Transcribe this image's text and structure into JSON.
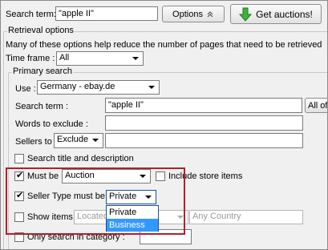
{
  "toolbar": {
    "search_label": "Search term:",
    "search_value": "\"apple II\"",
    "options_label": "Options",
    "options_icon": "double-chevron-up-icon",
    "get_auctions_label": "Get auctions!",
    "get_auctions_icon": "green-down-arrow-icon"
  },
  "retrieval": {
    "title": "Retrieval options",
    "description": "Many of these options help reduce the number of pages that need to be retrieved",
    "timeframe_label": "Time frame :",
    "timeframe_value": "All"
  },
  "primary": {
    "title": "Primary search",
    "use_label": "Use :",
    "use_value": "Germany - ebay.de",
    "search_label": "Search term :",
    "search_value": "\"apple II\"",
    "all_of_label": "All of",
    "exclude_label": "Words to exclude :",
    "exclude_value": "",
    "sellers_label": "Sellers to",
    "sellers_value": "Exclude",
    "sellers_input": "",
    "title_desc_label": "Search title and description",
    "title_desc_checked": false,
    "must_be_label": "Must be",
    "must_be_checked": true,
    "must_be_value": "Auction",
    "store_items_label": "Include store items",
    "store_items_checked": false,
    "seller_type_label": "Seller Type must be",
    "seller_type_checked": true,
    "seller_type_value": "Private",
    "seller_type_options": [
      "Private",
      "Business"
    ],
    "show_items_label": "Show items",
    "show_items_checked": false,
    "located_value": "Located",
    "country_value": "Any Country",
    "category_label": "Only search in category :",
    "category_checked": false,
    "category_value": ""
  },
  "colors": {
    "highlight_box": "#b0202a",
    "selection": "#3399ff",
    "dropdown_border": "#1e4fa0"
  }
}
